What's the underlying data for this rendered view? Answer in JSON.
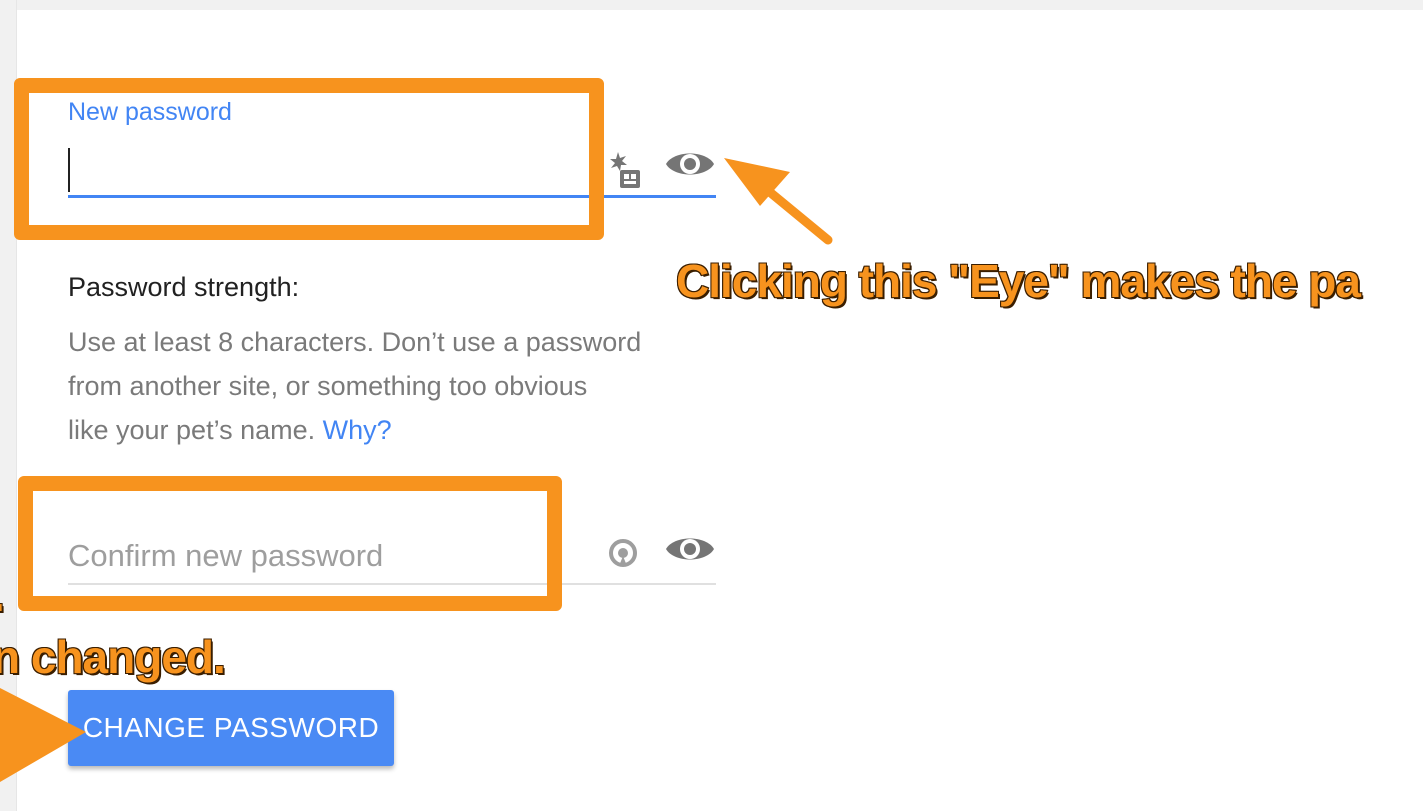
{
  "form": {
    "new_password": {
      "label": "New password",
      "value": ""
    },
    "strength": {
      "title": "Password strength:",
      "line1": "Use at least 8 characters. Don’t use a password",
      "line2": "from another site, or something too obvious",
      "line3_prefix": "like your pet’s name. ",
      "why_link": "Why?"
    },
    "confirm_password": {
      "placeholder": "Confirm new password",
      "value": ""
    },
    "submit_label": "CHANGE PASSWORD"
  },
  "icons": {
    "new_password_manager": "password-manager-icon",
    "new_password_toggle": "eye-icon",
    "confirm_password_sync": "sync-icon",
    "confirm_password_toggle": "eye-icon"
  },
  "annotations": {
    "eye_note": "Clicking this \"Eye\" makes the pa",
    "left_fragment_1": ".",
    "left_fragment_2": "n changed."
  },
  "colors": {
    "accent": "#4285f4",
    "button": "#4a8af4",
    "annotation": "#f7931e",
    "icon": "#757575"
  }
}
